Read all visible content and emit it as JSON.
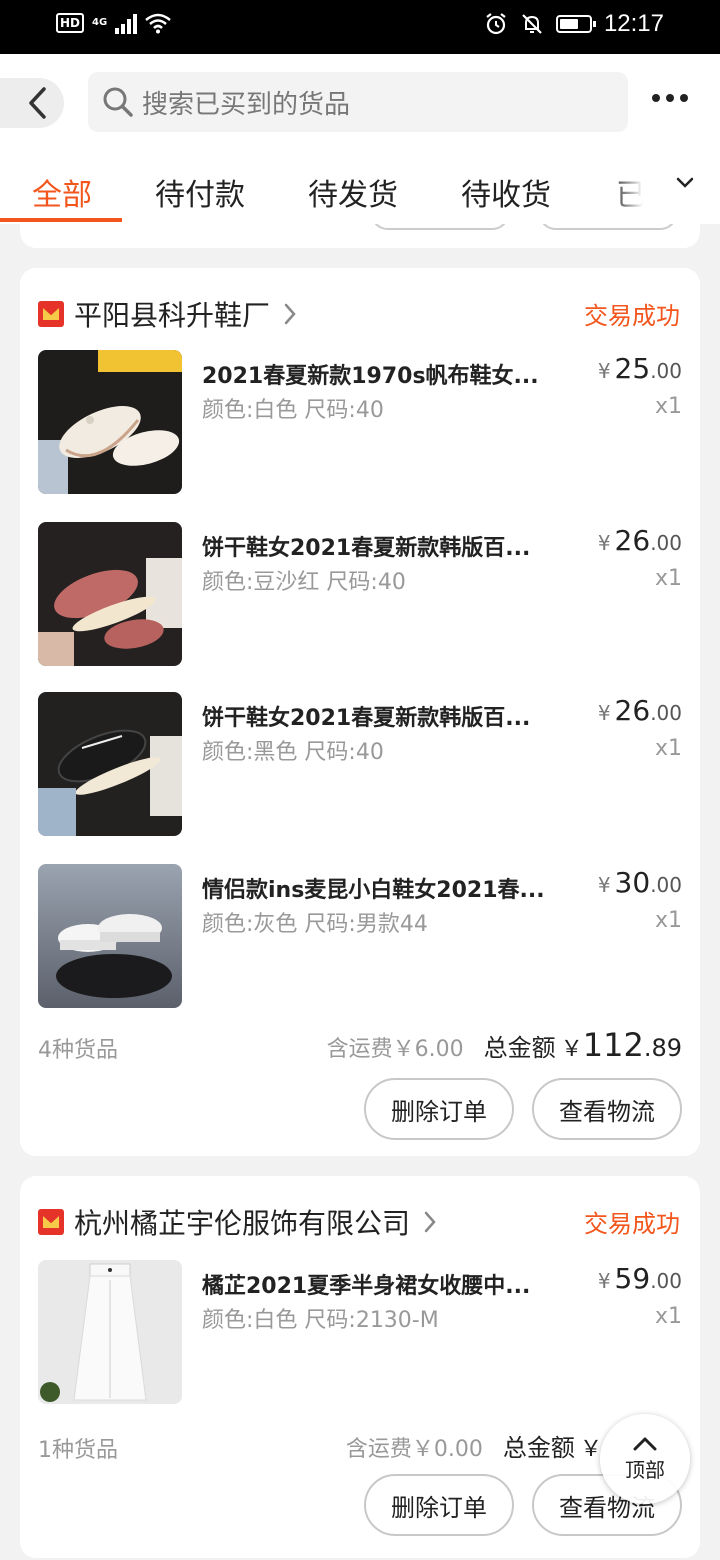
{
  "status_bar": {
    "network": "HD",
    "net_type": "4G",
    "time": "12:17"
  },
  "search": {
    "placeholder": "搜索已买到的货品"
  },
  "tabs": [
    {
      "label": "全部",
      "active": true
    },
    {
      "label": "待付款",
      "active": false
    },
    {
      "label": "待发货",
      "active": false
    },
    {
      "label": "待收货",
      "active": false
    },
    {
      "label": "已",
      "active": false
    }
  ],
  "orders": [
    {
      "shop": "平阳县科升鞋厂",
      "status": "交易成功",
      "items": [
        {
          "title": "2021春夏新款1970s帆布鞋女...",
          "spec": "颜色:白色 尺码:40",
          "currency": "¥",
          "price_int": "25",
          "price_dec": ".00",
          "qty": "x1"
        },
        {
          "title": "饼干鞋女2021春夏新款韩版百...",
          "spec": "颜色:豆沙红 尺码:40",
          "currency": "¥",
          "price_int": "26",
          "price_dec": ".00",
          "qty": "x1"
        },
        {
          "title": "饼干鞋女2021春夏新款韩版百...",
          "spec": "颜色:黑色 尺码:40",
          "currency": "¥",
          "price_int": "26",
          "price_dec": ".00",
          "qty": "x1"
        },
        {
          "title": "情侣款ins麦昆小白鞋女2021春...",
          "spec": "颜色:灰色 尺码:男款44",
          "currency": "¥",
          "price_int": "30",
          "price_dec": ".00",
          "qty": "x1"
        }
      ],
      "count_label": "4种货品",
      "shipping_label": "含运费￥6.00",
      "total_label": "总金额",
      "total_currency": "￥",
      "total_int": "112",
      "total_dec": ".89",
      "btn_delete": "删除订单",
      "btn_logistics": "查看物流"
    },
    {
      "shop": "杭州橘芷宇伦服饰有限公司",
      "status": "交易成功",
      "items": [
        {
          "title": "橘芷2021夏季半身裙女收腰中...",
          "spec": "颜色:白色 尺码:2130-M",
          "currency": "¥",
          "price_int": "59",
          "price_dec": ".00",
          "qty": "x1"
        }
      ],
      "count_label": "1种货品",
      "shipping_label": "含运费￥0.00",
      "total_label": "总金额",
      "total_currency": "￥",
      "btn_delete": "删除订单",
      "btn_logistics": "查看物流"
    }
  ],
  "float_button": {
    "label": "顶部"
  },
  "colors": {
    "accent": "#f3561c",
    "background": "#f2f2f2",
    "card": "#ffffff"
  }
}
